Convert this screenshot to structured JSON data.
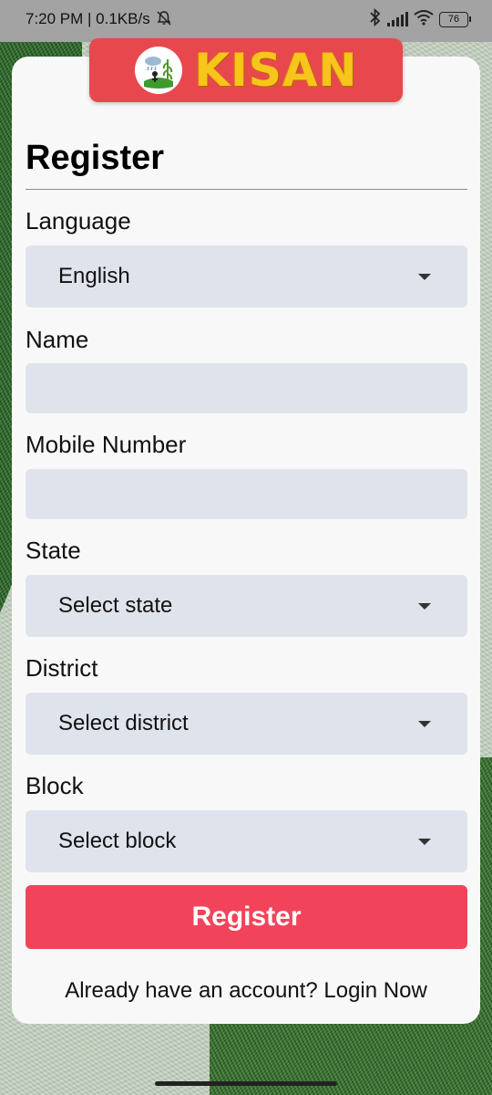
{
  "status_bar": {
    "time_speed": "7:20 PM | 0.1KB/s",
    "battery": "76",
    "icons": [
      "mute-bell-icon",
      "bluetooth-icon",
      "signal-icon",
      "wifi-icon",
      "battery-icon"
    ]
  },
  "brand": {
    "name": "KISAN",
    "banner_color": "#e8484d",
    "text_color": "#f7c51b"
  },
  "form": {
    "title": "Register",
    "language": {
      "label": "Language",
      "value": "English"
    },
    "name": {
      "label": "Name",
      "value": ""
    },
    "mobile": {
      "label": "Mobile Number",
      "value": ""
    },
    "state": {
      "label": "State",
      "value": "Select state"
    },
    "district": {
      "label": "District",
      "value": "Select district"
    },
    "block": {
      "label": "Block",
      "value": "Select block"
    },
    "submit_label": "Register",
    "submit_color": "#f1445a",
    "login_prompt": "Already have an account?",
    "login_link": "Login Now"
  }
}
